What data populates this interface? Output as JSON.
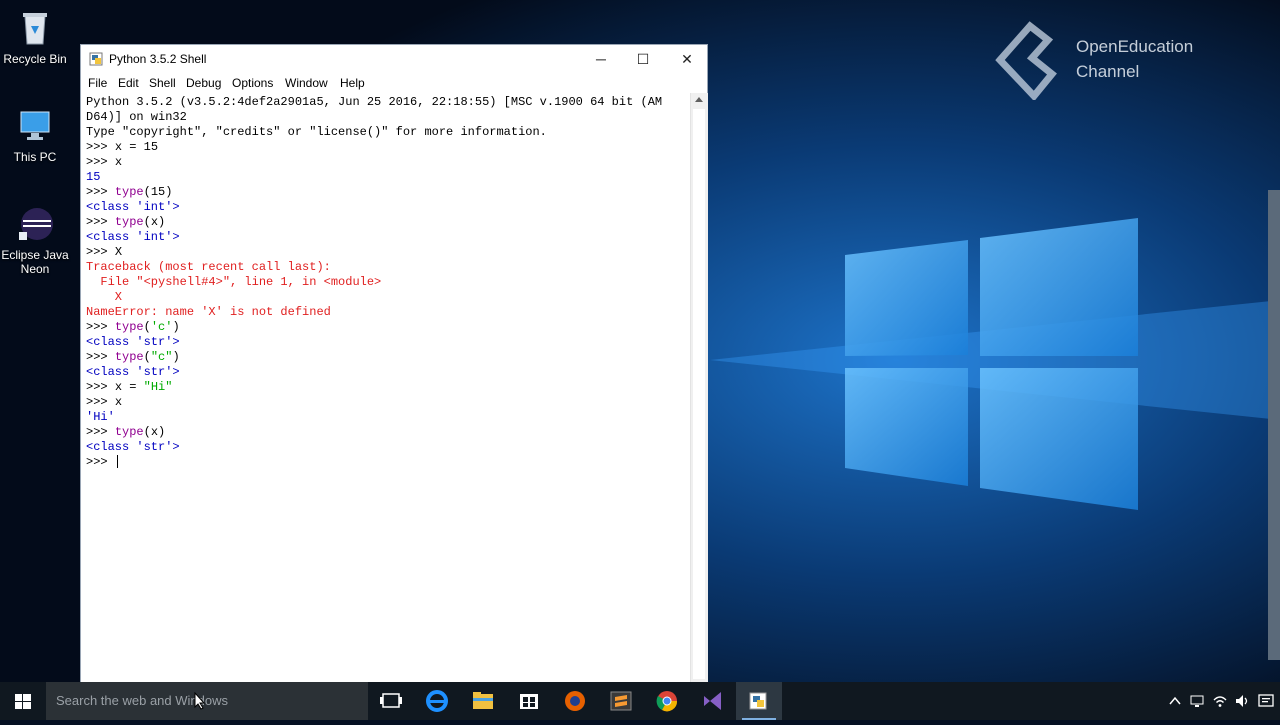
{
  "desktop": {
    "icons": [
      {
        "label": "Recycle Bin",
        "icon": "recycle-bin-icon"
      },
      {
        "label": "This PC",
        "icon": "computer-icon"
      },
      {
        "label": "Eclipse Java Neon",
        "icon": "eclipse-icon"
      }
    ],
    "watermark": {
      "line1": "OpenEducation",
      "line2": "Channel"
    }
  },
  "window": {
    "title": "Python 3.5.2 Shell",
    "controls": {
      "minimize": "─",
      "maximize": "☐",
      "close": "✕"
    },
    "menu": [
      "File",
      "Edit",
      "Shell",
      "Debug",
      "Options",
      "Window",
      "Help"
    ]
  },
  "shell": {
    "lines": [
      {
        "segments": [
          {
            "text": "Python 3.5.2 (v3.5.2:4def2a2901a5, Jun 25 2016, 22:18:55) [MSC v.1900 64 bit (AM",
            "style": "default"
          }
        ]
      },
      {
        "segments": [
          {
            "text": "D64)] on win32",
            "style": "default"
          }
        ]
      },
      {
        "segments": [
          {
            "text": "Type \"copyright\", \"credits\" or \"license()\" for more information.",
            "style": "default"
          }
        ]
      },
      {
        "segments": [
          {
            "text": ">>> ",
            "style": "default"
          },
          {
            "text": "x = 15",
            "style": "default"
          }
        ]
      },
      {
        "segments": [
          {
            "text": ">>> ",
            "style": "default"
          },
          {
            "text": "x",
            "style": "default"
          }
        ]
      },
      {
        "segments": [
          {
            "text": "15",
            "style": "blue"
          }
        ]
      },
      {
        "segments": [
          {
            "text": ">>> ",
            "style": "default"
          },
          {
            "text": "type",
            "style": "purple"
          },
          {
            "text": "(15)",
            "style": "default"
          }
        ]
      },
      {
        "segments": [
          {
            "text": "<class 'int'>",
            "style": "blue"
          }
        ]
      },
      {
        "segments": [
          {
            "text": ">>> ",
            "style": "default"
          },
          {
            "text": "type",
            "style": "purple"
          },
          {
            "text": "(x)",
            "style": "default"
          }
        ]
      },
      {
        "segments": [
          {
            "text": "<class 'int'>",
            "style": "blue"
          }
        ]
      },
      {
        "segments": [
          {
            "text": ">>> ",
            "style": "default"
          },
          {
            "text": "X",
            "style": "default"
          }
        ]
      },
      {
        "segments": [
          {
            "text": "Traceback (most recent call last):",
            "style": "red"
          }
        ]
      },
      {
        "segments": [
          {
            "text": "  File \"<pyshell#4>\", line 1, in <module>",
            "style": "red"
          }
        ]
      },
      {
        "segments": [
          {
            "text": "    X",
            "style": "red"
          }
        ]
      },
      {
        "segments": [
          {
            "text": "NameError: name 'X' is not defined",
            "style": "red"
          }
        ]
      },
      {
        "segments": [
          {
            "text": ">>> ",
            "style": "default"
          },
          {
            "text": "type",
            "style": "purple"
          },
          {
            "text": "(",
            "style": "default"
          },
          {
            "text": "'c'",
            "style": "green"
          },
          {
            "text": ")",
            "style": "default"
          }
        ]
      },
      {
        "segments": [
          {
            "text": "<class 'str'>",
            "style": "blue"
          }
        ]
      },
      {
        "segments": [
          {
            "text": ">>> ",
            "style": "default"
          },
          {
            "text": "type",
            "style": "purple"
          },
          {
            "text": "(",
            "style": "default"
          },
          {
            "text": "\"c\"",
            "style": "green"
          },
          {
            "text": ")",
            "style": "default"
          }
        ]
      },
      {
        "segments": [
          {
            "text": "<class 'str'>",
            "style": "blue"
          }
        ]
      },
      {
        "segments": [
          {
            "text": ">>> ",
            "style": "default"
          },
          {
            "text": "x = ",
            "style": "default"
          },
          {
            "text": "\"Hi\"",
            "style": "green"
          }
        ]
      },
      {
        "segments": [
          {
            "text": ">>> ",
            "style": "default"
          },
          {
            "text": "x",
            "style": "default"
          }
        ]
      },
      {
        "segments": [
          {
            "text": "'Hi'",
            "style": "blue"
          }
        ]
      },
      {
        "segments": [
          {
            "text": ">>> ",
            "style": "default"
          },
          {
            "text": "type",
            "style": "purple"
          },
          {
            "text": "(x)",
            "style": "default"
          }
        ]
      },
      {
        "segments": [
          {
            "text": "<class 'str'>",
            "style": "blue"
          }
        ]
      },
      {
        "segments": [
          {
            "text": ">>> ",
            "style": "default"
          }
        ]
      }
    ]
  },
  "taskbar": {
    "search_placeholder": "Search the web and Windows",
    "apps": [
      {
        "name": "task-view-icon",
        "active": false
      },
      {
        "name": "edge-icon",
        "active": false
      },
      {
        "name": "file-explorer-icon",
        "active": false
      },
      {
        "name": "store-icon",
        "active": false
      },
      {
        "name": "firefox-icon",
        "active": false
      },
      {
        "name": "sublime-text-icon",
        "active": false
      },
      {
        "name": "chrome-icon",
        "active": false
      },
      {
        "name": "visual-studio-icon",
        "active": false
      },
      {
        "name": "python-idle-icon",
        "active": true
      }
    ],
    "tray": [
      "chevron-up-icon",
      "network-icon",
      "wifi-icon",
      "volume-icon",
      "notifications-icon"
    ]
  },
  "colors": {
    "prompt_keyword": "#900090",
    "output": "#0000c0",
    "string": "#00aa00",
    "error": "#e02020"
  }
}
